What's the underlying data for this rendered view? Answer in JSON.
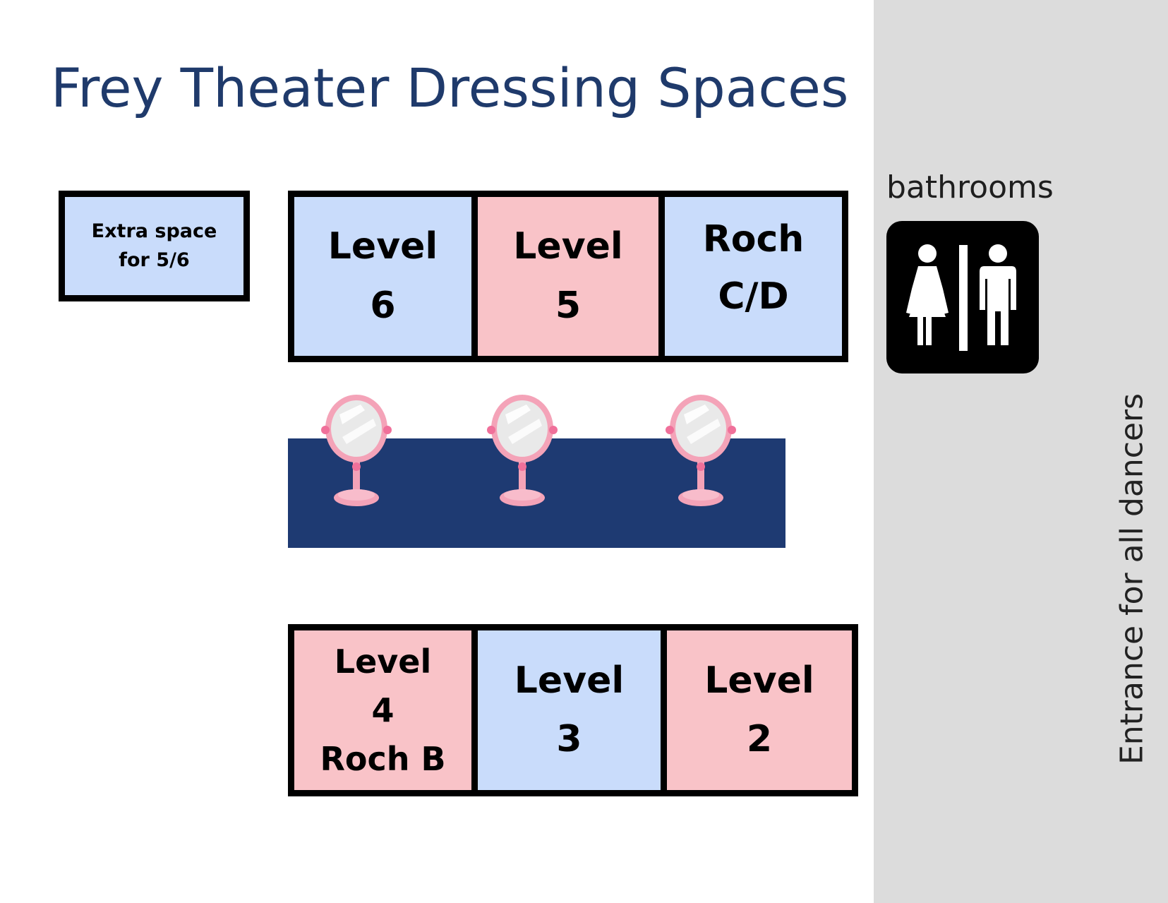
{
  "title": "Frey Theater Dressing Spaces",
  "extra_space": {
    "line1": "Extra space",
    "line2": "for 5/6"
  },
  "top_rooms": [
    {
      "line1": "Level",
      "line2": "6",
      "color": "#c9dcfb"
    },
    {
      "line1": "Level",
      "line2": "5",
      "color": "#f9c3c8"
    },
    {
      "line1": "Roch",
      "line2": "C/D",
      "color": "#c9dcfb"
    }
  ],
  "bottom_rooms": [
    {
      "line1": "Level",
      "line2": "4",
      "line3": "Roch B",
      "color": "#f9c3c8"
    },
    {
      "line1": "Level",
      "line2": "3",
      "color": "#c9dcfb"
    },
    {
      "line1": "Level",
      "line2": "2",
      "color": "#f9c3c8"
    }
  ],
  "bathrooms_label": "bathrooms",
  "bathrooms_icon": "restroom-icon",
  "mirror_icon": "vanity-mirror-icon",
  "entrance_label": "Entrance for all dancers",
  "colors": {
    "title": "#1f3a6b",
    "vanity_counter": "#1e3a72",
    "sidebar": "#dcdcdc",
    "blue_room": "#c9dcfb",
    "pink_room": "#f9c3c8"
  }
}
